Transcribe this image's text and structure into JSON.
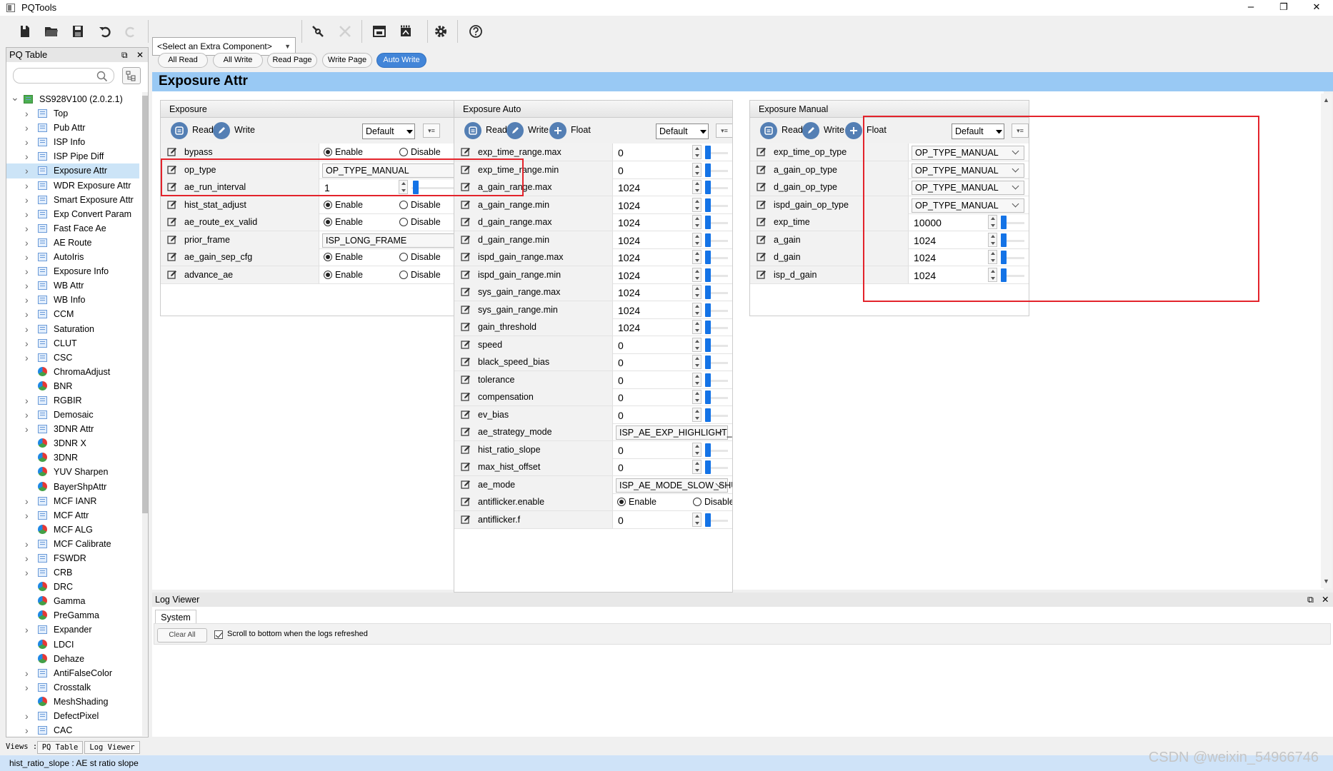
{
  "window": {
    "title": "PQTools",
    "minimize": "–",
    "restore": "❐",
    "close": "✕"
  },
  "toolbar": {
    "extra_component": "<Select an Extra Component>"
  },
  "left_panel": {
    "title": "PQ Table",
    "tree": [
      {
        "label": "SS928V100 (2.0.2.1)",
        "root": true
      },
      {
        "label": "Top",
        "icon": "table"
      },
      {
        "label": "Pub Attr",
        "icon": "table"
      },
      {
        "label": "ISP Info",
        "icon": "table"
      },
      {
        "label": "ISP Pipe Diff",
        "icon": "table"
      },
      {
        "label": "Exposure Attr",
        "icon": "table",
        "selected": true
      },
      {
        "label": "WDR Exposure Attr",
        "icon": "table"
      },
      {
        "label": "Smart Exposure Attr",
        "icon": "table"
      },
      {
        "label": "Exp Convert Param",
        "icon": "table"
      },
      {
        "label": "Fast Face Ae",
        "icon": "table"
      },
      {
        "label": "AE Route",
        "icon": "table"
      },
      {
        "label": "AutoIris",
        "icon": "table"
      },
      {
        "label": "Exposure Info",
        "icon": "table"
      },
      {
        "label": "WB Attr",
        "icon": "table"
      },
      {
        "label": "WB Info",
        "icon": "table"
      },
      {
        "label": "CCM",
        "icon": "table"
      },
      {
        "label": "Saturation",
        "icon": "table"
      },
      {
        "label": "CLUT",
        "icon": "table"
      },
      {
        "label": "CSC",
        "icon": "table"
      },
      {
        "label": "ChromaAdjust",
        "icon": "ball"
      },
      {
        "label": "BNR",
        "icon": "ball"
      },
      {
        "label": "RGBIR",
        "icon": "table"
      },
      {
        "label": "Demosaic",
        "icon": "table"
      },
      {
        "label": "3DNR Attr",
        "icon": "table"
      },
      {
        "label": "3DNR X",
        "icon": "ball"
      },
      {
        "label": "3DNR",
        "icon": "ball"
      },
      {
        "label": "YUV Sharpen",
        "icon": "ball"
      },
      {
        "label": "BayerShpAttr",
        "icon": "ball"
      },
      {
        "label": "MCF IANR",
        "icon": "table"
      },
      {
        "label": "MCF Attr",
        "icon": "table"
      },
      {
        "label": "MCF ALG",
        "icon": "ball"
      },
      {
        "label": "MCF Calibrate",
        "icon": "table"
      },
      {
        "label": "FSWDR",
        "icon": "table"
      },
      {
        "label": "CRB",
        "icon": "table"
      },
      {
        "label": "DRC",
        "icon": "ball"
      },
      {
        "label": "Gamma",
        "icon": "ball"
      },
      {
        "label": "PreGamma",
        "icon": "ball"
      },
      {
        "label": "Expander",
        "icon": "table"
      },
      {
        "label": "LDCI",
        "icon": "ball"
      },
      {
        "label": "Dehaze",
        "icon": "ball"
      },
      {
        "label": "AntiFalseColor",
        "icon": "table"
      },
      {
        "label": "Crosstalk",
        "icon": "table"
      },
      {
        "label": "MeshShading",
        "icon": "ball"
      },
      {
        "label": "DefectPixel",
        "icon": "table"
      },
      {
        "label": "CAC",
        "icon": "table"
      }
    ]
  },
  "views": {
    "label": "Views :",
    "tabs": [
      "PQ Table",
      "Log Viewer"
    ]
  },
  "actions": [
    "All Read",
    "All Write",
    "Read Page",
    "Write Page",
    "Auto Write"
  ],
  "page_title": "Exposure Attr",
  "labels": {
    "read": "Read",
    "write": "Write",
    "float": "Float",
    "default": "Default",
    "enable": "Enable",
    "disable": "Disable"
  },
  "exposure": {
    "title": "Exposure",
    "rows": [
      {
        "name": "bypass",
        "type": "radio",
        "value": "Enable"
      },
      {
        "name": "op_type",
        "type": "select",
        "value": "OP_TYPE_MANUAL"
      },
      {
        "name": "ae_run_interval",
        "type": "slider",
        "value": "1",
        "level": 0.02
      },
      {
        "name": "hist_stat_adjust",
        "type": "radio",
        "value": "Enable"
      },
      {
        "name": "ae_route_ex_valid",
        "type": "radio",
        "value": "Enable"
      },
      {
        "name": "prior_frame",
        "type": "select",
        "value": "ISP_LONG_FRAME"
      },
      {
        "name": "ae_gain_sep_cfg",
        "type": "radio",
        "value": "Enable"
      },
      {
        "name": "advance_ae",
        "type": "radio",
        "value": "Enable"
      }
    ]
  },
  "exposure_auto": {
    "title": "Exposure Auto",
    "rows": [
      {
        "name": "exp_time_range.max",
        "type": "slider",
        "value": "0",
        "level": 0
      },
      {
        "name": "exp_time_range.min",
        "type": "slider",
        "value": "0",
        "level": 0
      },
      {
        "name": "a_gain_range.max",
        "type": "slider",
        "value": "1024",
        "level": 0
      },
      {
        "name": "a_gain_range.min",
        "type": "slider",
        "value": "1024",
        "level": 0
      },
      {
        "name": "d_gain_range.max",
        "type": "slider",
        "value": "1024",
        "level": 0
      },
      {
        "name": "d_gain_range.min",
        "type": "slider",
        "value": "1024",
        "level": 0
      },
      {
        "name": "ispd_gain_range.max",
        "type": "slider",
        "value": "1024",
        "level": 0
      },
      {
        "name": "ispd_gain_range.min",
        "type": "slider",
        "value": "1024",
        "level": 0
      },
      {
        "name": "sys_gain_range.max",
        "type": "slider",
        "value": "1024",
        "level": 0
      },
      {
        "name": "sys_gain_range.min",
        "type": "slider",
        "value": "1024",
        "level": 0
      },
      {
        "name": "gain_threshold",
        "type": "slider",
        "value": "1024",
        "level": 0
      },
      {
        "name": "speed",
        "type": "slider",
        "value": "0",
        "level": 0
      },
      {
        "name": "black_speed_bias",
        "type": "slider",
        "value": "0",
        "level": 0
      },
      {
        "name": "tolerance",
        "type": "slider",
        "value": "0",
        "level": 0
      },
      {
        "name": "compensation",
        "type": "slider",
        "value": "0",
        "level": 0
      },
      {
        "name": "ev_bias",
        "type": "slider",
        "value": "0",
        "level": 0
      },
      {
        "name": "ae_strategy_mode",
        "type": "select",
        "value": "ISP_AE_EXP_HIGHLIGHT_PRIOR"
      },
      {
        "name": "hist_ratio_slope",
        "type": "slider",
        "value": "0",
        "level": 0
      },
      {
        "name": "max_hist_offset",
        "type": "slider",
        "value": "0",
        "level": 0
      },
      {
        "name": "ae_mode",
        "type": "select",
        "value": "ISP_AE_MODE_SLOW_SHUTTER"
      },
      {
        "name": "antiflicker.enable",
        "type": "radio",
        "value": "Enable"
      },
      {
        "name": "antiflicker.f",
        "type": "slider",
        "value": "0",
        "level": 0
      }
    ]
  },
  "exposure_manual": {
    "title": "Exposure Manual",
    "rows": [
      {
        "name": "exp_time_op_type",
        "type": "select",
        "value": "OP_TYPE_MANUAL"
      },
      {
        "name": "a_gain_op_type",
        "type": "select",
        "value": "OP_TYPE_MANUAL"
      },
      {
        "name": "d_gain_op_type",
        "type": "select",
        "value": "OP_TYPE_MANUAL"
      },
      {
        "name": "ispd_gain_op_type",
        "type": "select",
        "value": "OP_TYPE_MANUAL"
      },
      {
        "name": "exp_time",
        "type": "slider",
        "value": "10000",
        "level": 0
      },
      {
        "name": "a_gain",
        "type": "slider",
        "value": "1024",
        "level": 0
      },
      {
        "name": "d_gain",
        "type": "slider",
        "value": "1024",
        "level": 0
      },
      {
        "name": "isp_d_gain",
        "type": "slider",
        "value": "1024",
        "level": 0
      }
    ]
  },
  "log": {
    "title": "Log Viewer",
    "tab": "System",
    "clear": "Clear All",
    "scroll_checkbox": "Scroll to bottom when the logs refreshed",
    "scroll_checked": true
  },
  "status": "hist_ratio_slope : AE st ratio slope",
  "watermark": "CSDN @weixin_54966746",
  "colors": {
    "accent": "#4285d8",
    "title_bar": "#99c9f4",
    "slider_knob": "#1473e6",
    "highlight": "#e3232b"
  }
}
